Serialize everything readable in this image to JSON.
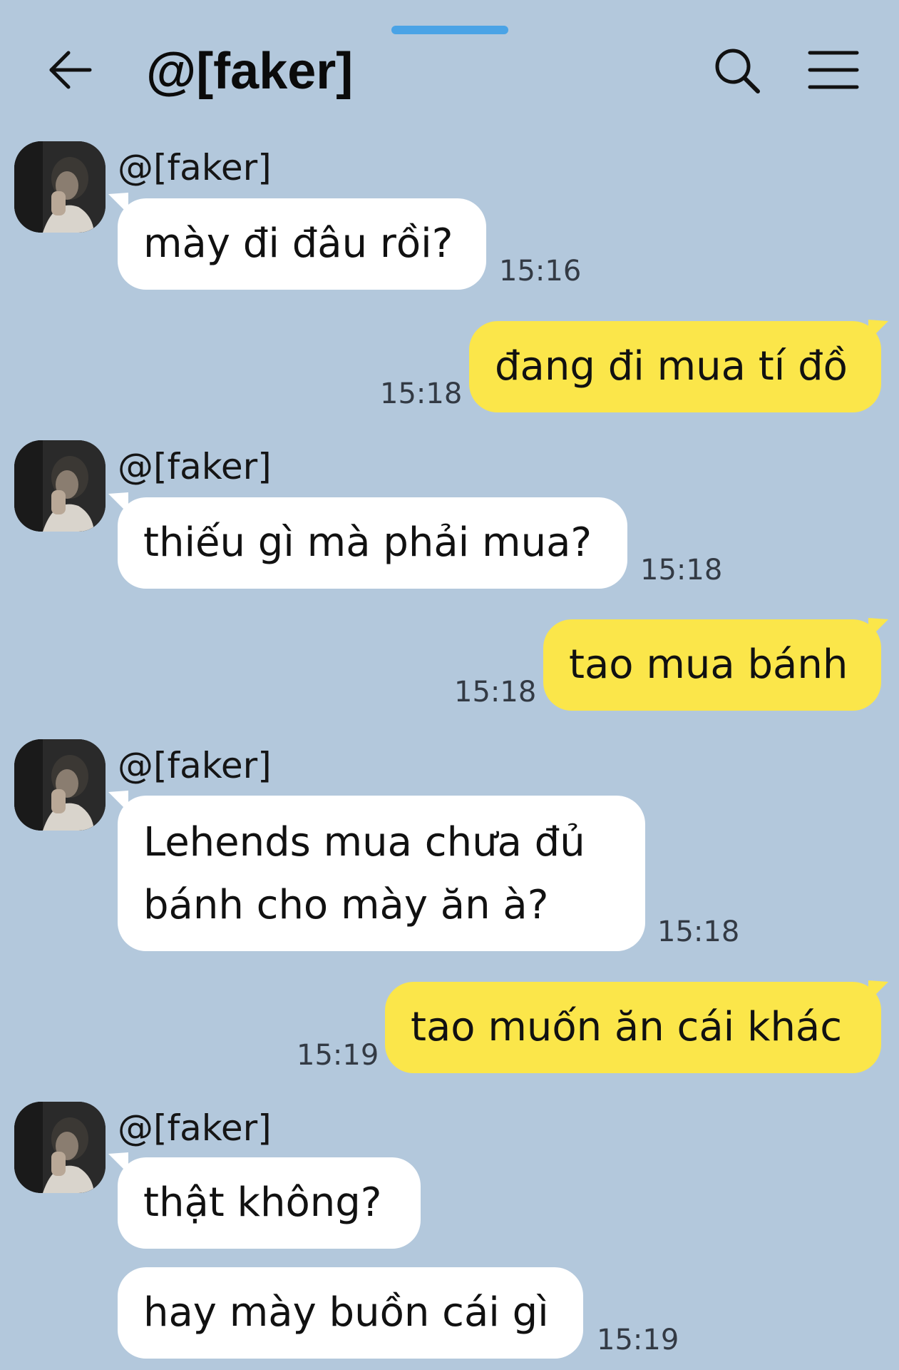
{
  "header": {
    "title": "@[faker]",
    "back_icon": "arrow-left-icon",
    "search_icon": "search-icon",
    "menu_icon": "hamburger-menu-icon"
  },
  "colors": {
    "background": "#b3c8dc",
    "incoming_bubble": "#ffffff",
    "outgoing_bubble": "#fbe64a",
    "handle": "#4aa3e6"
  },
  "messages": [
    {
      "sender": "@[faker]",
      "text": "mày đi đâu rồi?",
      "time": "15:16"
    },
    {
      "text": "đang đi mua tí đồ",
      "time": "15:18"
    },
    {
      "sender": "@[faker]",
      "text": "thiếu gì mà phải mua?",
      "time": "15:18"
    },
    {
      "text": "tao mua bánh",
      "time": "15:18"
    },
    {
      "sender": "@[faker]",
      "line1": "Lehends mua chưa đủ",
      "line2": "bánh cho mày ăn à?",
      "time": "15:18"
    },
    {
      "text": "tao muốn ăn cái khác",
      "time": "15:19"
    },
    {
      "sender": "@[faker]",
      "text": "thật không?"
    },
    {
      "text": "hay mày buồn cái gì",
      "time": "15:19"
    }
  ]
}
